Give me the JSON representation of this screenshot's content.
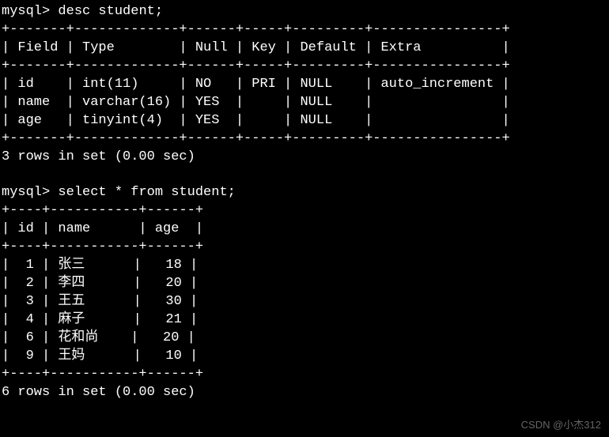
{
  "prompt": "mysql>",
  "commands": {
    "desc": "desc student;",
    "select": "select * from student;"
  },
  "desc_table": {
    "border_top": "+-------+-------------+------+-----+---------+----------------+",
    "header": "| Field | Type        | Null | Key | Default | Extra          |",
    "border_mid": "+-------+-------------+------+-----+---------+----------------+",
    "rows": [
      "| id    | int(11)     | NO   | PRI | NULL    | auto_increment |",
      "| name  | varchar(16) | YES  |     | NULL    |                |",
      "| age   | tinyint(4)  | YES  |     | NULL    |                |"
    ],
    "border_bot": "+-------+-------------+------+-----+---------+----------------+",
    "summary": "3 rows in set (0.00 sec)"
  },
  "select_table": {
    "border_top": "+----+-----------+------+",
    "header": "| id | name      | age  |",
    "border_mid": "+----+-----------+------+",
    "rows": [
      "|  1 | 张三      |   18 |",
      "|  2 | 李四      |   20 |",
      "|  3 | 王五      |   30 |",
      "|  4 | 麻子      |   21 |",
      "|  6 | 花和尚    |   20 |",
      "|  9 | 王妈      |   10 |"
    ],
    "border_bot": "+----+-----------+------+",
    "summary": "6 rows in set (0.00 sec)"
  },
  "chart_data": {
    "type": "table",
    "tables": [
      {
        "name": "desc student",
        "columns": [
          "Field",
          "Type",
          "Null",
          "Key",
          "Default",
          "Extra"
        ],
        "rows": [
          [
            "id",
            "int(11)",
            "NO",
            "PRI",
            "NULL",
            "auto_increment"
          ],
          [
            "name",
            "varchar(16)",
            "YES",
            "",
            "NULL",
            ""
          ],
          [
            "age",
            "tinyint(4)",
            "YES",
            "",
            "NULL",
            ""
          ]
        ]
      },
      {
        "name": "select * from student",
        "columns": [
          "id",
          "name",
          "age"
        ],
        "rows": [
          [
            1,
            "张三",
            18
          ],
          [
            2,
            "李四",
            20
          ],
          [
            3,
            "王五",
            30
          ],
          [
            4,
            "麻子",
            21
          ],
          [
            6,
            "花和尚",
            20
          ],
          [
            9,
            "王妈",
            10
          ]
        ]
      }
    ]
  },
  "watermark": "CSDN @小杰312"
}
